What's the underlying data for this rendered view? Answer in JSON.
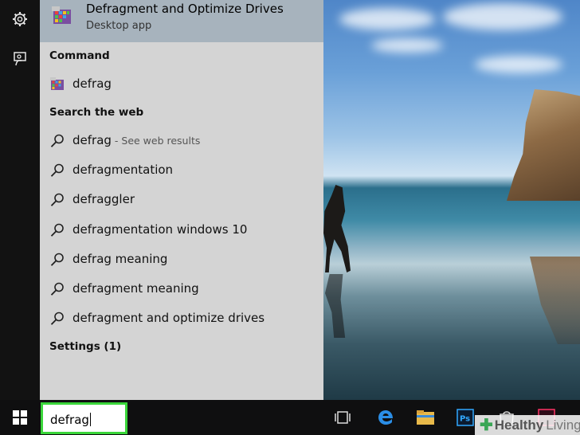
{
  "best_match": {
    "title": "Defragment and Optimize Drives",
    "subtitle": "Desktop app"
  },
  "sections": {
    "command": "Command",
    "web": "Search the web",
    "settings": "Settings (1)"
  },
  "command_item": {
    "label": "defrag",
    "icon": "defrag-app-icon"
  },
  "web_results": [
    {
      "label": "defrag",
      "hint": " - See web results"
    },
    {
      "label": "defragmentation"
    },
    {
      "label": "defraggler"
    },
    {
      "label": "defragmentation windows 10"
    },
    {
      "label": "defrag meaning"
    },
    {
      "label": "defragment meaning"
    },
    {
      "label": "defragment and optimize drives"
    }
  ],
  "search": {
    "value": "defrag"
  },
  "taskbar": {
    "icons": [
      "task-view-icon",
      "edge-icon",
      "file-explorer-icon",
      "photoshop-icon",
      "store-icon",
      "indesign-icon"
    ],
    "photoshop_label": "Ps"
  },
  "watermark": {
    "part1": "Healthy",
    "part2": "Living"
  },
  "colors": {
    "highlight": "#3ad63a",
    "best_match_bg": "#a7b3bd",
    "panel_bg": "#d4d4d4"
  }
}
